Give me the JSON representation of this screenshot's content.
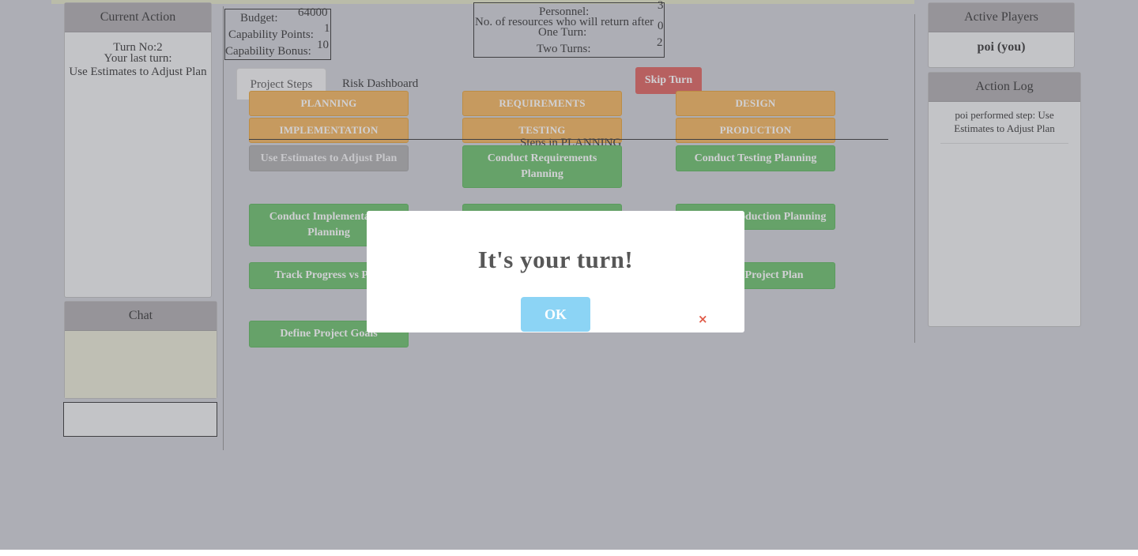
{
  "left": {
    "current_action": {
      "title": "Current Action",
      "turn_line": "Turn No:2",
      "last_turn_label": "Your last turn:",
      "last_turn_value": "Use Estimates to Adjust Plan"
    },
    "chat": {
      "title": "Chat"
    }
  },
  "stats": {
    "budget_label": "Budget:",
    "budget_value": "64000",
    "capability_points_label": "Capability Points:",
    "capability_points_value": "1",
    "capability_bonus_label": "Capability Bonus:",
    "capability_bonus_value": "10"
  },
  "personnel": {
    "personnel_label": "Personnel:",
    "personnel_value": "3",
    "return_label": "No. of resources who will return after",
    "return_value": "0",
    "one_turn_label": "One Turn:",
    "two_turns_label": "Two Turns:",
    "two_turns_value": "2"
  },
  "tabs": {
    "project_steps": "Project Steps",
    "risk_dashboard": "Risk Dashboard"
  },
  "skip_turn": "Skip Turn",
  "phases": [
    "PLANNING",
    "REQUIREMENTS",
    "DESIGN",
    "IMPLEMENTATION",
    "TESTING",
    "PRODUCTION"
  ],
  "steps_title": "Steps in PLANNING",
  "steps": {
    "s1": "Use Estimates to Adjust Plan",
    "s2": "Conduct Requirements Planning",
    "s3": "Conduct Testing Planning",
    "s4": "Conduct Implementation Planning",
    "s6": "Conduct Production Planning",
    "s7": "Track Progress vs Plan",
    "s9": "Update Project Plan",
    "s10": "Define Project Goals"
  },
  "right": {
    "players": {
      "title": "Active Players",
      "player": "poi (you)"
    },
    "log": {
      "title": "Action Log",
      "entry": "poi performed step: Use Estimates to Adjust Plan"
    }
  },
  "modal": {
    "title": "It's your turn!",
    "ok": "OK",
    "close": "×"
  },
  "colors": {
    "phase": "#f0ad4e",
    "step": "#5cb85c",
    "skip": "#d9534f",
    "ok": "#8cd4f5"
  }
}
